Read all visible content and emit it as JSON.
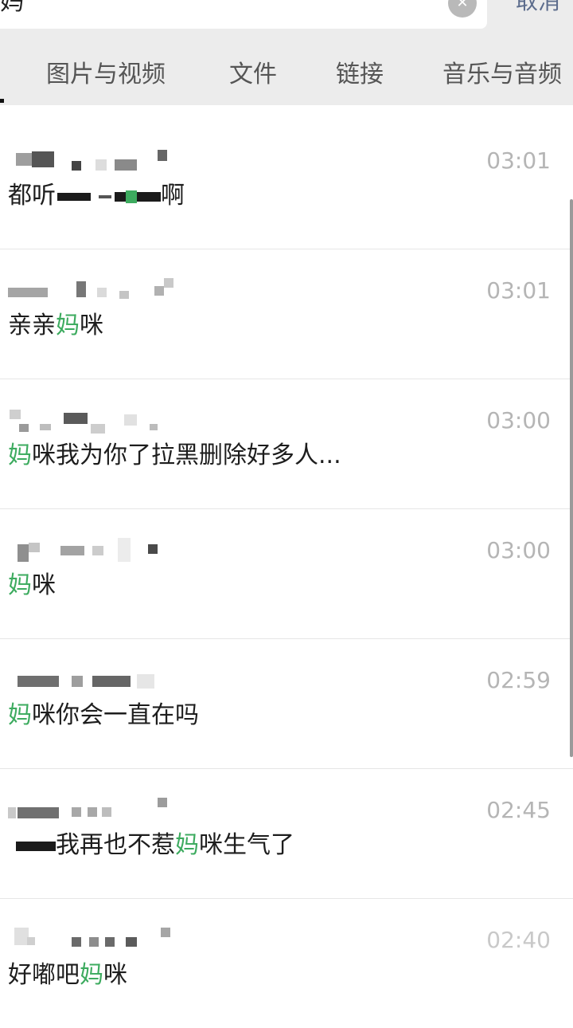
{
  "search": {
    "query": "妈",
    "cancel_label": "取消"
  },
  "tabs": [
    {
      "label": "图片与视频"
    },
    {
      "label": "文件"
    },
    {
      "label": "链接"
    },
    {
      "label": "音乐与音频"
    }
  ],
  "results": [
    {
      "time": "03:01",
      "message": {
        "before": "都听",
        "highlight": "",
        "after": "啊"
      }
    },
    {
      "time": "03:01",
      "message": {
        "before": "亲亲",
        "highlight": "妈",
        "after": "咪"
      }
    },
    {
      "time": "03:00",
      "message": {
        "before": "",
        "highlight": "妈",
        "after": "咪我为你了拉黑删除好多人..."
      }
    },
    {
      "time": "03:00",
      "message": {
        "before": "",
        "highlight": "妈",
        "after": "咪"
      }
    },
    {
      "time": "02:59",
      "message": {
        "before": "",
        "highlight": "妈",
        "after": "咪你会一直在吗"
      }
    },
    {
      "time": "02:45",
      "message": {
        "before": "我再也不惹",
        "highlight": "妈",
        "after": "咪生气了"
      }
    },
    {
      "time": "02:40",
      "message": {
        "before": "好嘟吧",
        "highlight": "妈",
        "after": "咪"
      }
    }
  ]
}
